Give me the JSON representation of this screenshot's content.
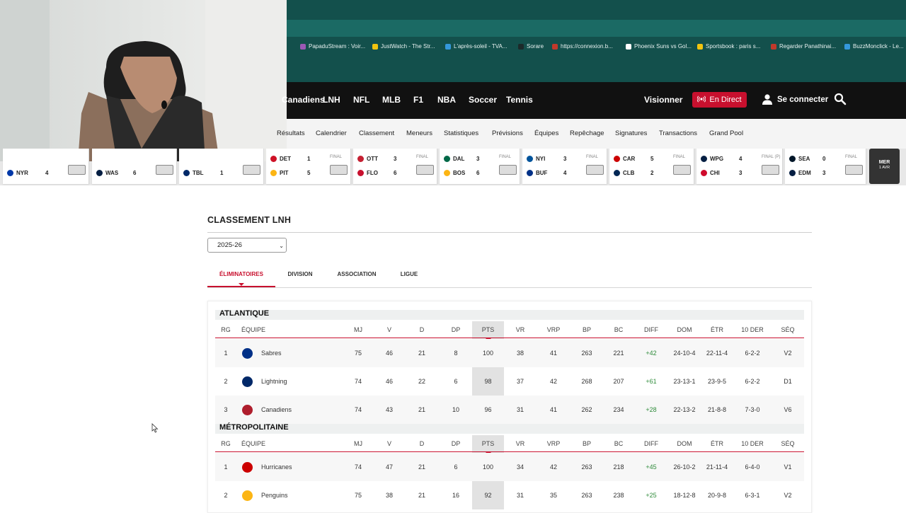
{
  "bookmarks": [
    {
      "label": "PapaduStream : Voir...",
      "color": "#9b59b6"
    },
    {
      "label": "JustWatch - The Str...",
      "color": "#f1c40f"
    },
    {
      "label": "L'après-soleil - TVA...",
      "color": "#3498db"
    },
    {
      "label": "Sorare",
      "color": "#1c2a2a"
    },
    {
      "label": "https://connexion.b...",
      "color": "#c0392b"
    },
    {
      "label": "Phoenix Suns vs Gol...",
      "color": "#ffffff"
    },
    {
      "label": "Sportsbook : paris s...",
      "color": "#f1c40f"
    },
    {
      "label": "Regarder Panathinai...",
      "color": "#c0392b"
    },
    {
      "label": "BuzzMonclick - Le...",
      "color": "#3498db"
    }
  ],
  "main_nav": {
    "items": [
      "Canadiens",
      "LNH",
      "NFL",
      "MLB",
      "F1",
      "NBA",
      "Soccer",
      "Tennis"
    ],
    "visionner": "Visionner",
    "live": "En Direct",
    "login": "Se connecter"
  },
  "sub_nav": {
    "items": [
      "Résultats",
      "Calendrier",
      "Classement",
      "Meneurs",
      "Statistiques",
      "Prévisions",
      "Équipes",
      "Repêchage",
      "Signatures",
      "Transactions",
      "Grand Pool"
    ]
  },
  "scoreboard": {
    "games": [
      {
        "away": "",
        "away_score": "",
        "home": "NYR",
        "home_score": "4",
        "status": "",
        "away_color": "#ffffff",
        "home_color": "#0038a8"
      },
      {
        "away": "",
        "away_score": "",
        "home": "WAS",
        "home_score": "6",
        "status": "",
        "away_color": "#ffffff",
        "home_color": "#041e42"
      },
      {
        "away": "",
        "away_score": "",
        "home": "TBL",
        "home_score": "1",
        "status": "",
        "away_color": "#ffffff",
        "home_color": "#002868"
      },
      {
        "away": "DET",
        "away_score": "1",
        "home": "PIT",
        "home_score": "5",
        "status": "FINAL",
        "away_color": "#ce1126",
        "home_color": "#fcb514"
      },
      {
        "away": "OTT",
        "away_score": "3",
        "home": "FLO",
        "home_score": "6",
        "status": "FINAL",
        "away_color": "#c52032",
        "home_color": "#c8102e"
      },
      {
        "away": "DAL",
        "away_score": "3",
        "home": "BOS",
        "home_score": "6",
        "status": "FINAL",
        "away_color": "#006847",
        "home_color": "#fcb514"
      },
      {
        "away": "NYI",
        "away_score": "3",
        "home": "BUF",
        "home_score": "4",
        "status": "FINAL",
        "away_color": "#00539b",
        "home_color": "#003087"
      },
      {
        "away": "CAR",
        "away_score": "5",
        "home": "CLB",
        "home_score": "2",
        "status": "FINAL",
        "away_color": "#cc0000",
        "home_color": "#002654"
      },
      {
        "away": "WPG",
        "away_score": "4",
        "home": "CHI",
        "home_score": "3",
        "status": "FINAL (P)",
        "away_color": "#041e42",
        "home_color": "#cf0a2c"
      },
      {
        "away": "SEA",
        "away_score": "0",
        "home": "EDM",
        "home_score": "3",
        "status": "FINAL",
        "away_color": "#001628",
        "home_color": "#041e42"
      }
    ],
    "date": {
      "day": "MER",
      "date": "1 AVR"
    }
  },
  "page": {
    "title": "CLASSEMENT LNH",
    "season": "2025-26",
    "tabs": [
      "ÉLIMINATOIRES",
      "DIVISION",
      "ASSOCIATION",
      "LIGUE"
    ],
    "active_tab": "ÉLIMINATOIRES"
  },
  "table_headers": [
    "RG",
    "ÉQUIPE",
    "MJ",
    "V",
    "D",
    "DP",
    "PTS",
    "VR",
    "VRP",
    "BP",
    "BC",
    "DIFF",
    "DOM",
    "ÉTR",
    "10 DER",
    "SÉQ"
  ],
  "divisions": [
    {
      "name": "ATLANTIQUE",
      "teams": [
        {
          "rg": "1",
          "team": "Sabres",
          "mj": "75",
          "v": "46",
          "d": "21",
          "dp": "8",
          "pts": "100",
          "vr": "38",
          "vrp": "41",
          "bp": "263",
          "bc": "221",
          "diff": "+42",
          "dom": "24-10-4",
          "etr": "22-11-4",
          "last10": "6-2-2",
          "seq": "V2",
          "logo_color": "#003087"
        },
        {
          "rg": "2",
          "team": "Lightning",
          "mj": "74",
          "v": "46",
          "d": "22",
          "dp": "6",
          "pts": "98",
          "vr": "37",
          "vrp": "42",
          "bp": "268",
          "bc": "207",
          "diff": "+61",
          "dom": "23-13-1",
          "etr": "23-9-5",
          "last10": "6-2-2",
          "seq": "D1",
          "logo_color": "#002868"
        },
        {
          "rg": "3",
          "team": "Canadiens",
          "mj": "74",
          "v": "43",
          "d": "21",
          "dp": "10",
          "pts": "96",
          "vr": "31",
          "vrp": "41",
          "bp": "262",
          "bc": "234",
          "diff": "+28",
          "dom": "22-13-2",
          "etr": "21-8-8",
          "last10": "7-3-0",
          "seq": "V6",
          "logo_color": "#af1e2d"
        }
      ]
    },
    {
      "name": "MÉTROPOLITAINE",
      "teams": [
        {
          "rg": "1",
          "team": "Hurricanes",
          "mj": "74",
          "v": "47",
          "d": "21",
          "dp": "6",
          "pts": "100",
          "vr": "34",
          "vrp": "42",
          "bp": "263",
          "bc": "218",
          "diff": "+45",
          "dom": "26-10-2",
          "etr": "21-11-4",
          "last10": "6-4-0",
          "seq": "V1",
          "logo_color": "#cc0000"
        },
        {
          "rg": "2",
          "team": "Penguins",
          "mj": "75",
          "v": "38",
          "d": "21",
          "dp": "16",
          "pts": "92",
          "vr": "31",
          "vrp": "35",
          "bp": "263",
          "bc": "238",
          "diff": "+25",
          "dom": "18-12-8",
          "etr": "20-9-8",
          "last10": "6-3-1",
          "seq": "V2",
          "logo_color": "#fcb514"
        }
      ]
    }
  ],
  "colors": {
    "accent": "#c8102e",
    "positive": "#2e8b3a",
    "nav_bg": "#111111",
    "chrome": "#13504c"
  }
}
